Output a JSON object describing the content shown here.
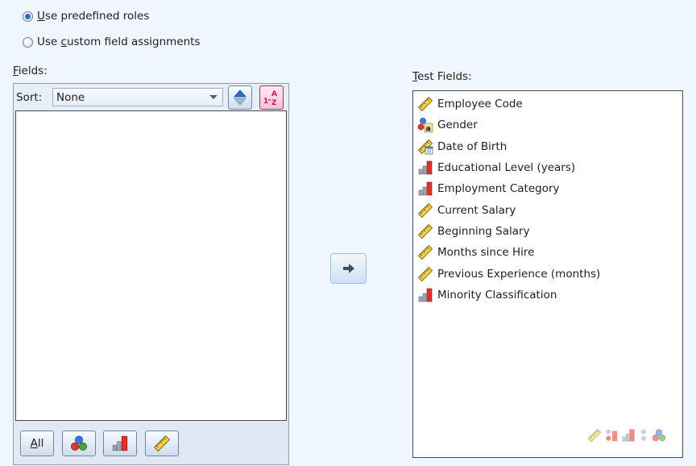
{
  "roles": {
    "predefined_label": "Use predefined roles",
    "predefined_mnemonic": "U",
    "predefined_rest": "se predefined roles",
    "custom_pre": "Use ",
    "custom_mnemonic": "c",
    "custom_rest": "ustom field assignments",
    "selected": "predefined"
  },
  "fields": {
    "label_mnemonic": "F",
    "label_rest": "ields:",
    "sort_label": "Sort:",
    "sort_value": "None",
    "items": []
  },
  "filter_buttons": {
    "all_mnemonic": "A",
    "all_rest": "ll"
  },
  "test_fields": {
    "label_mnemonic": "T",
    "label_rest": "est Fields:",
    "items": [
      {
        "label": "Employee Code",
        "icon": "scale-icon"
      },
      {
        "label": "Gender",
        "icon": "nominal-string-icon"
      },
      {
        "label": "Date of Birth",
        "icon": "date-scale-icon"
      },
      {
        "label": "Educational Level (years)",
        "icon": "ordinal-icon"
      },
      {
        "label": "Employment Category",
        "icon": "ordinal-icon"
      },
      {
        "label": "Current Salary",
        "icon": "scale-icon"
      },
      {
        "label": "Beginning Salary",
        "icon": "scale-icon"
      },
      {
        "label": "Months since Hire",
        "icon": "scale-icon"
      },
      {
        "label": "Previous Experience (months)",
        "icon": "scale-icon"
      },
      {
        "label": "Minority Classification",
        "icon": "ordinal-icon"
      }
    ]
  },
  "colors": {
    "accent": "#2f6fc5",
    "background": "#f0f6fd"
  }
}
